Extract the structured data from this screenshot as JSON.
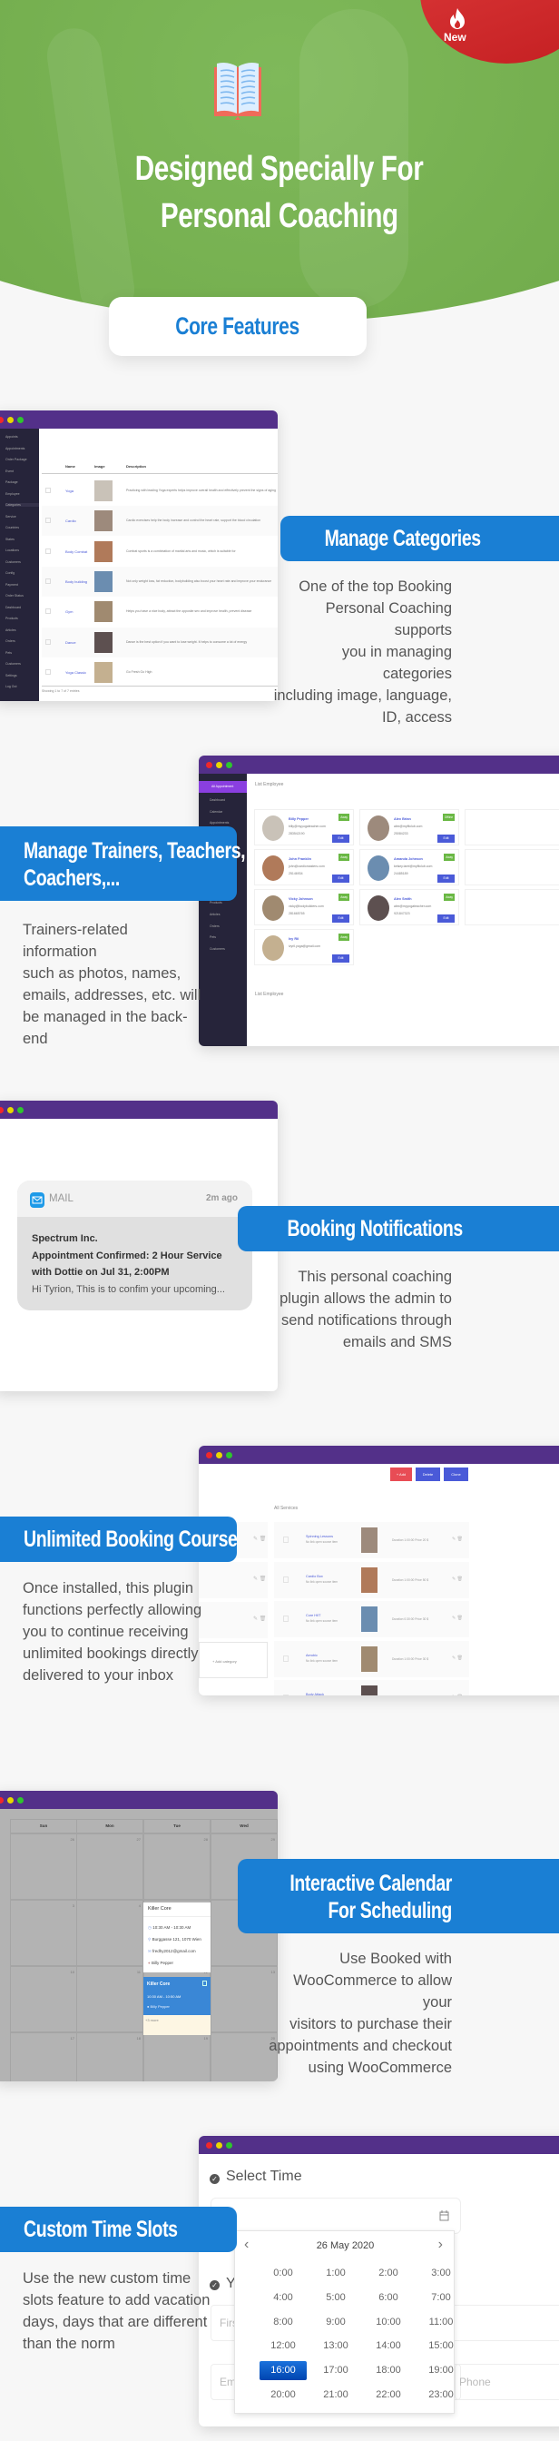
{
  "hero": {
    "badge": "New",
    "badge_icon": "fire-icon",
    "title_line1": "Designed Specially For",
    "title_line2": "Personal Coaching",
    "core_features": "Core Features",
    "book_icon": "open-book-icon"
  },
  "colors": {
    "accent": "#1a7fd4",
    "hero_green": "#71ab4b",
    "window_bar": "#533089",
    "badge_red": "#d02a2a"
  },
  "sections": {
    "categories": {
      "title": "Manage Categories",
      "description": [
        "One of the top Booking",
        "Personal Coaching supports",
        "you in managing categories",
        "including image, language,",
        "ID, access"
      ],
      "mock": {
        "sidebar": [
          "Appoints",
          "Appointments",
          "Order Package",
          "Event",
          "Package",
          "Employee",
          "Categories",
          "Service",
          "Countries",
          "States",
          "Locations",
          "Customers",
          "Config",
          "Payment",
          "Order Status",
          "Dashboard",
          "Products",
          "Articles",
          "Orders",
          "Pets",
          "Customers",
          "Settings",
          "Log Out"
        ],
        "columns": [
          "Name",
          "Image",
          "Description"
        ],
        "rows": [
          {
            "name": "Yoga",
            "desc": "Practicing with leading Yoga experts helps improve overall health and effectively prevent the signs of aging"
          },
          {
            "name": "Cardio",
            "desc": "Cardio exercises help the body increase and control the heart rate, support the blood circulation"
          },
          {
            "name": "Body Combat",
            "desc": "Combat sports is a combination of martial arts and music, which is suitable for"
          },
          {
            "name": "Body building",
            "desc": "Not only weight loss, fat reduction, bodybuilding also boost your heart rate and improve your endurance"
          },
          {
            "name": "Gym",
            "desc": "Helps you have a nice body, attract the opposite sex and improve health, prevent disease"
          },
          {
            "name": "Dance",
            "desc": "Dance is the best option if you want to lose weight. It helps to consume a lot of energy"
          },
          {
            "name": "Yoga Classic",
            "desc": "Go Fresh Go High"
          }
        ],
        "footer": "Showing 1 to 7 of 7 entries"
      }
    },
    "trainers": {
      "title_line1": "Manage Trainers, Teachers,",
      "title_line2": "Coachers,...",
      "description": [
        "Trainers-related information",
        "such as photos, names,",
        "emails, addresses, etc. will",
        "be managed in the back-end"
      ],
      "mock": {
        "menu_active": "All Appointment",
        "sidebar": [
          "Dashboard",
          "Calendar",
          "Appointments",
          "Locations",
          "Customers",
          "Config",
          "Payment",
          "Order Status",
          "Dashboard",
          "Products",
          "Articles",
          "Orders",
          "Pets",
          "Customers"
        ],
        "list_title": "List Employee",
        "list_title_2": "List Employee",
        "edit_label": "Edit",
        "employees": [
          {
            "name": "Billy Pepper",
            "email": "billy@myyogateacher.com",
            "phone": "283542190",
            "status": "Away"
          },
          {
            "name": "Alex Brian",
            "email": "alex@myfitclub.com",
            "phone": "25084233",
            "status": "Offline"
          },
          {
            "name": "John Franklin",
            "email": "john@cardiomasters.com",
            "phone": "25146934",
            "status": "Away"
          },
          {
            "name": "Amanda Johnson",
            "email": "kelsey.tarel@myfitclub.com",
            "phone": "24485189",
            "status": "Away"
          },
          {
            "name": "Vicky Johnson",
            "email": "vicky@bodybuilders.com",
            "phone": "281665765",
            "status": "Away"
          },
          {
            "name": "Alex Smith",
            "email": "alex@myyogateacher.com",
            "phone": "921847323",
            "status": "Away"
          },
          {
            "name": "Ivy Ril",
            "email": "ivyril.yoga@gmail.com",
            "phone": "",
            "status": "Away"
          }
        ]
      }
    },
    "notifications": {
      "title": "Booking Notifications",
      "description": [
        "This personal coaching",
        "plugin allows the admin to",
        "send notifications through",
        "emails and SMS"
      ],
      "mock": {
        "app": "MAIL",
        "time": "2m ago",
        "sender": "Spectrum Inc.",
        "subject_line1": "Appointment Confirmed: 2 Hour Service",
        "subject_line2": "with Dottie on Jul 31, 2:00PM",
        "preview": "Hi Tyrion, This is to confim your upcoming..."
      }
    },
    "courses": {
      "title": "Unlimited Booking Course",
      "description": [
        "Once installed, this plugin",
        "functions perfectly allowing",
        "you to continue receiving",
        "unlimited bookings directly",
        "delivered to your inbox"
      ],
      "mock": {
        "buttons": {
          "add": "+ Add",
          "delete": "Delete",
          "clone": "Clone"
        },
        "list_title": "All Services",
        "add_category": "+ Add category",
        "services": [
          {
            "name": "Spinning Lessons",
            "sub": "No link open source item",
            "meta": "Duration 1:00:00  Price 20 $"
          },
          {
            "name": "Cardio Box",
            "sub": "No link open source item",
            "meta": "Duration 1:00:00  Price 50 $"
          },
          {
            "name": "Core HIIT",
            "sub": "No link open source item",
            "meta": "Duration 0:30:00  Price 30 $"
          },
          {
            "name": "Aerobic",
            "sub": "No link open source item",
            "meta": "Duration 1:00:00  Price 30 $"
          },
          {
            "name": "Body Attack",
            "sub": "No link open source item",
            "meta": "Duration 1:30:00  Price 55 $"
          }
        ]
      }
    },
    "calendar": {
      "title_line1": "Interactive Calendar",
      "title_line2": "For Scheduling",
      "description": [
        "Use Booked with",
        "WooCommerce to allow your",
        "visitors to purchase their",
        "appointments and checkout",
        "using WooCommerce"
      ],
      "mock": {
        "days": [
          "Sun",
          "Mon",
          "Tue",
          "Wed"
        ],
        "dates": [
          [
            "26",
            "27",
            "28",
            "29"
          ],
          [
            "3",
            "4",
            "5",
            "6"
          ],
          [
            "10",
            "11",
            "12",
            "13"
          ],
          [
            "17",
            "18",
            "19",
            "20"
          ]
        ],
        "popup": {
          "title": "Killer Core",
          "time": "10:30 AM - 10:30 AM",
          "address": "Burggasse 121, 1070 Wien",
          "email": "fredhy2012@gmail.com",
          "person": "Billy Pepper"
        },
        "event": {
          "title": "Killer Core",
          "time": "10:30 AM - 10:50 AM",
          "person": "Billy Pepper",
          "more": "+3 more"
        }
      }
    },
    "timeslots": {
      "title": "Custom Time Slots",
      "description": [
        "Use the new custom time",
        "slots feature to add vacation",
        "days, days that are different",
        "than the norm"
      ],
      "mock": {
        "step_title": "Select Time",
        "step2_title": "Y",
        "date": "26 May 2020",
        "slots": [
          "0:00",
          "1:00",
          "2:00",
          "3:00",
          "4:00",
          "5:00",
          "6:00",
          "7:00",
          "8:00",
          "9:00",
          "10:00",
          "11:00",
          "12:00",
          "13:00",
          "14:00",
          "15:00",
          "16:00",
          "17:00",
          "18:00",
          "19:00",
          "20:00",
          "21:00",
          "22:00",
          "23:00"
        ],
        "selected": "16:00",
        "placeholders": {
          "first": "First",
          "email": "Email",
          "phone": "Phone"
        }
      }
    }
  }
}
